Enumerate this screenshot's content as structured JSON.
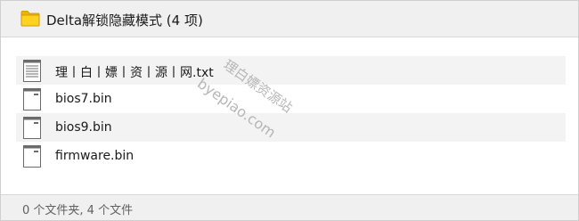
{
  "header": {
    "title": "Delta解锁隐藏模式 (4 项)",
    "icon": "folder-icon",
    "folder_color": "#f5c400"
  },
  "files": [
    {
      "name": "理丨白丨嫖丨资丨源丨网.txt",
      "icon": "text-file-icon"
    },
    {
      "name": "bios7.bin",
      "icon": "bin-file-icon"
    },
    {
      "name": "bios9.bin",
      "icon": "bin-file-icon"
    },
    {
      "name": "firmware.bin",
      "icon": "bin-file-icon"
    }
  ],
  "status": {
    "text": "0 个文件夹, 4 个文件"
  },
  "watermark": {
    "line1": "理白嫖资源站",
    "line2": "byepiao.com"
  }
}
